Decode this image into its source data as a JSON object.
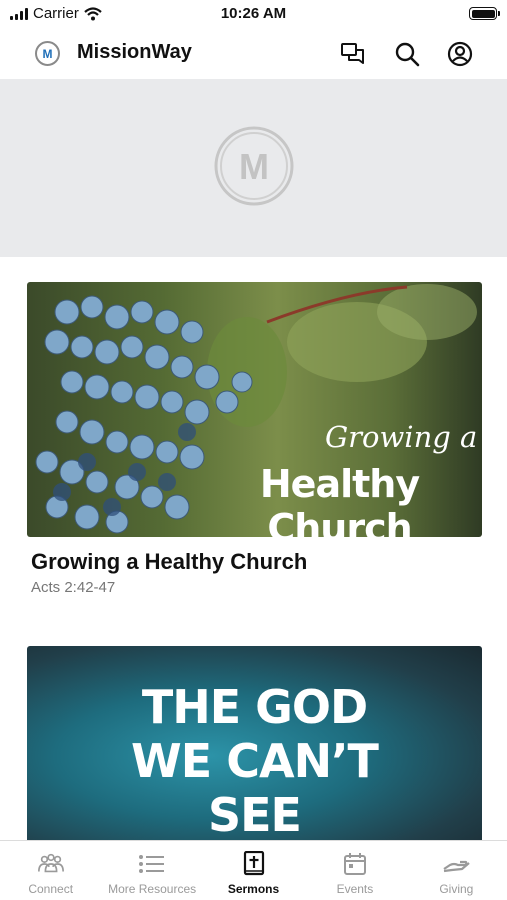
{
  "status_bar": {
    "carrier": "Carrier",
    "time": "10:26 AM"
  },
  "header": {
    "logo_letter": "M",
    "title": "MissionWay",
    "icons": [
      "chat-icon",
      "search-icon",
      "profile-icon"
    ]
  },
  "hero": {
    "logo_letter": "M"
  },
  "sermons": [
    {
      "title": "Growing a Healthy Church",
      "subtitle": "Acts 2:42-47",
      "art_script": "Growing a",
      "art_main": "Healthy Church"
    },
    {
      "title": "",
      "subtitle": "",
      "art_lines": [
        "THE GOD",
        "WE CAN’T",
        "SEE"
      ]
    }
  ],
  "tabs": [
    {
      "label": "Connect",
      "icon": "people-icon",
      "active": false
    },
    {
      "label": "More Resources",
      "icon": "list-icon",
      "active": false
    },
    {
      "label": "Sermons",
      "icon": "bible-icon",
      "active": true
    },
    {
      "label": "Events",
      "icon": "calendar-icon",
      "active": false
    },
    {
      "label": "Giving",
      "icon": "giving-hand-icon",
      "active": false
    }
  ],
  "colors": {
    "accent": "#1f6fb8",
    "tab_inactive": "#9a9a9a",
    "hero_bg": "#e9eaec"
  }
}
